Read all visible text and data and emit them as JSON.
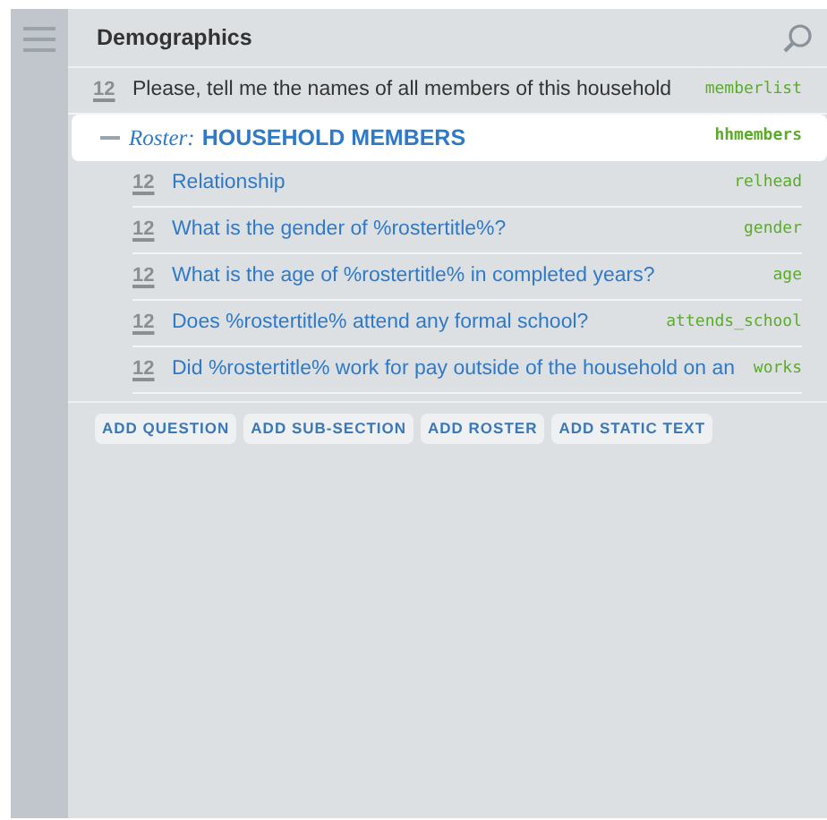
{
  "header": {
    "title": "Demographics"
  },
  "items": [
    {
      "kind": "question",
      "number": "12",
      "text": "Please, tell me the names of all members of this household",
      "variable": "memberlist"
    },
    {
      "kind": "roster",
      "expanded": true,
      "prefix": "Roster:",
      "text": "HOUSEHOLD MEMBERS",
      "variable": "hhmembers",
      "children": [
        {
          "kind": "question",
          "number": "12",
          "text": "Relationship",
          "variable": "relhead"
        },
        {
          "kind": "question",
          "number": "12",
          "text": "What is the gender of %rostertitle%?",
          "variable": "gender"
        },
        {
          "kind": "question",
          "number": "12",
          "text": "What is the age of %rostertitle% in completed years?",
          "variable": "age"
        },
        {
          "kind": "question",
          "number": "12",
          "text": "Does %rostertitle% attend any formal school?",
          "variable": "attends_school"
        },
        {
          "kind": "question",
          "number": "12",
          "text": "Did %rostertitle% work for pay outside of the household on an",
          "variable": "works"
        }
      ]
    }
  ],
  "buttons": [
    "ADD QUESTION",
    "ADD SUB-SECTION",
    "ADD ROSTER",
    "ADD STATIC TEXT"
  ]
}
